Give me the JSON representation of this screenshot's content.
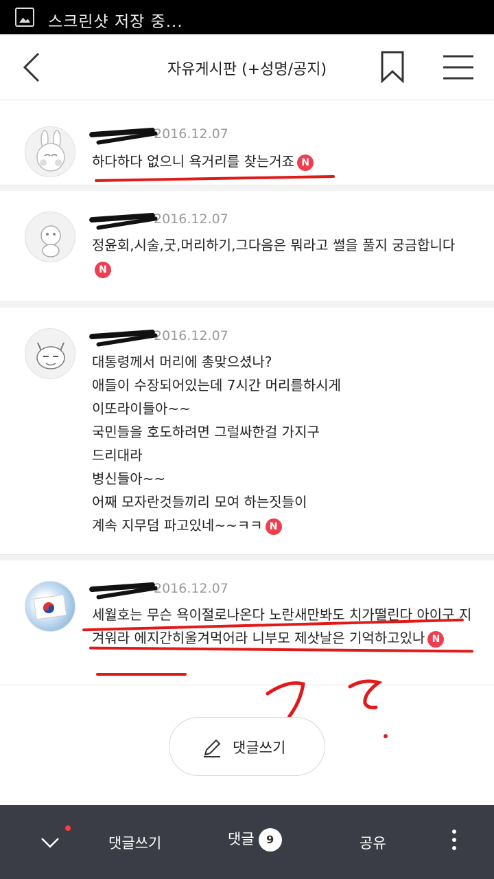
{
  "status_bar": {
    "notification_text": "스크린샷 저장 중..."
  },
  "header": {
    "title": "자유게시판 (+성명/공지)"
  },
  "comments": [
    {
      "date": "2016.12.07",
      "text": "하다하다 없으니 욕거리를 찾는거죠",
      "badge": "N"
    },
    {
      "date": "2016.12.07",
      "text": "정윤회,시술,굿,머리하기,그다음은 뭐라고 썰을 풀지 궁금합니다",
      "badge": "N"
    },
    {
      "date": "2016.12.07",
      "lines": [
        "대통령께서 머리에 총맞으셨나?",
        "애들이 수장되어있는데 7시간 머리를하시게",
        "이또라이들아~~",
        "국민들을 호도하려면 그럴싸한걸 가지구",
        "드리대라",
        "병신들아~~",
        "어째 모자란것들끼리 모여 하는짓들이"
      ],
      "last_line": "계속 지무덤 파고있네~~ㅋㅋ",
      "badge": "N"
    },
    {
      "date": "2016.12.07",
      "text": "세월호는 무슨 욕이절로나온다 노란새만봐도 치가떨린다 아이구 지겨워라 에지간히울겨먹어라 니부모 제삿날은 기억하고있나",
      "badge": "N"
    }
  ],
  "write_comment_button": {
    "label": "댓글쓰기"
  },
  "bottom_bar": {
    "write_label": "댓글쓰기",
    "comments_label": "댓글",
    "comments_count": "9",
    "share_label": "공유"
  },
  "colors": {
    "accent_red": "#ee3e4f",
    "bottom_bar": "#3a3d45",
    "annotation_red": "#e01919"
  },
  "icons": [
    "image-icon",
    "back-arrow-icon",
    "bookmark-icon",
    "hamburger-menu-icon",
    "pencil-icon",
    "chevron-down-icon",
    "more-vertical-icon"
  ]
}
